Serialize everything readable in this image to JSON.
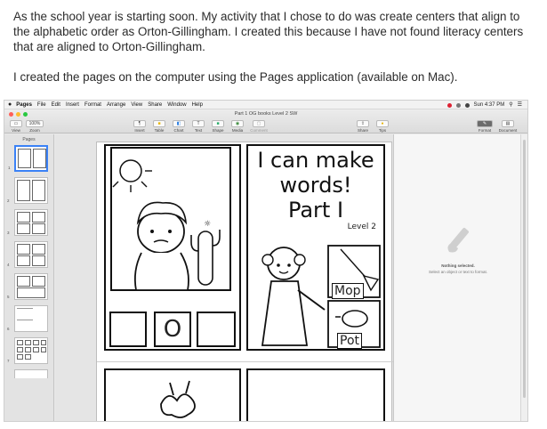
{
  "intro": {
    "paragraph1": "As the school year is starting soon. My activity that I chose to do was create centers that align to the alphabetic order as Orton-Gillingham. I created this because I have not found literacy centers that are aligned to Orton-Gillingham.",
    "paragraph2": "I created the pages on the computer using the Pages application (available on Mac)."
  },
  "menubar": {
    "apple": "",
    "items": [
      "Pages",
      "File",
      "Edit",
      "Insert",
      "Format",
      "Arrange",
      "View",
      "Share",
      "Window",
      "Help"
    ],
    "clock": "Sun 4:37 PM"
  },
  "window": {
    "title": "Part 1 OG books Level 2 SW",
    "view_label": "View",
    "zoom_label": "Zoom",
    "zoom_value": "100%",
    "tools": [
      "Insert",
      "Table",
      "Chart",
      "Text",
      "Shape",
      "Media",
      "Comment"
    ],
    "right_tools": [
      "Share",
      "Tips"
    ],
    "inspector_tabs": [
      "Format",
      "Document"
    ]
  },
  "sidebar": {
    "header": "Pages",
    "page_numbers": [
      "1",
      "2",
      "3",
      "4",
      "5",
      "6",
      "7"
    ]
  },
  "worksheet": {
    "title_line1": "I can make",
    "title_line2": "words!",
    "title_line3": "Part I",
    "level": "Level 2",
    "letter_box_middle": "O",
    "label_mop": "Mop",
    "label_pot": "Pot"
  },
  "inspector": {
    "nothing_selected": "Nothing selected.",
    "hint": "Select an object or text to format."
  },
  "colors": {
    "selection": "#3b82f6",
    "traffic_red": "#ff5f57",
    "traffic_yellow": "#febc2e",
    "traffic_green": "#28c840"
  }
}
